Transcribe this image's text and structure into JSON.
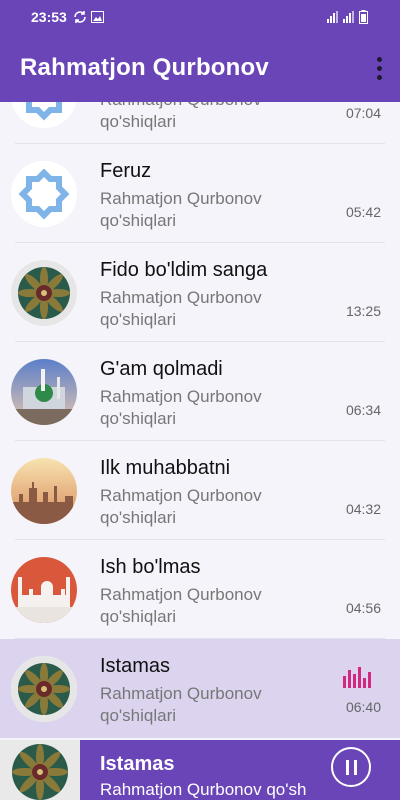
{
  "status": {
    "time": "23:53",
    "left_icons": [
      "sync-icon",
      "image-icon"
    ],
    "right_icons": [
      "signal-icon",
      "signal-icon",
      "battery-icon"
    ]
  },
  "app_bar": {
    "title": "Rahmatjon Qurbonov",
    "menu_icon": "more-vertical-icon"
  },
  "colors": {
    "primary": "#6a45b8",
    "active_row": "#dcd3ef",
    "equalizer": "#d1297f"
  },
  "songs": [
    {
      "title": "",
      "artist": "Rahmatjon Qurbonov qo'shiqlari",
      "duration": "07:04",
      "art": "octagon-star"
    },
    {
      "title": "Feruz",
      "artist": "Rahmatjon Qurbonov qo'shiqlari",
      "duration": "05:42",
      "art": "octagon-star"
    },
    {
      "title": "Fido bo'ldim sanga",
      "artist": "Rahmatjon Qurbonov qo'shiqlari",
      "duration": "13:25",
      "art": "mandala"
    },
    {
      "title": "G'am qolmadi",
      "artist": "Rahmatjon Qurbonov qo'shiqlari",
      "duration": "06:34",
      "art": "mosque-photo"
    },
    {
      "title": "Ilk muhabbatni",
      "artist": "Rahmatjon Qurbonov qo'shiqlari",
      "duration": "04:32",
      "art": "city-sunset"
    },
    {
      "title": "Ish bo'lmas",
      "artist": "Rahmatjon Qurbonov qo'shiqlari",
      "duration": "04:56",
      "art": "mosque-orange"
    },
    {
      "title": "Istamas",
      "artist": "Rahmatjon Qurbonov qo'shiqlari",
      "duration": "06:40",
      "art": "mandala",
      "playing": true
    }
  ],
  "now_playing": {
    "title": "Istamas",
    "artist": "Rahmatjon Qurbonov qo'shiqlari",
    "control_icon": "pause-icon"
  }
}
